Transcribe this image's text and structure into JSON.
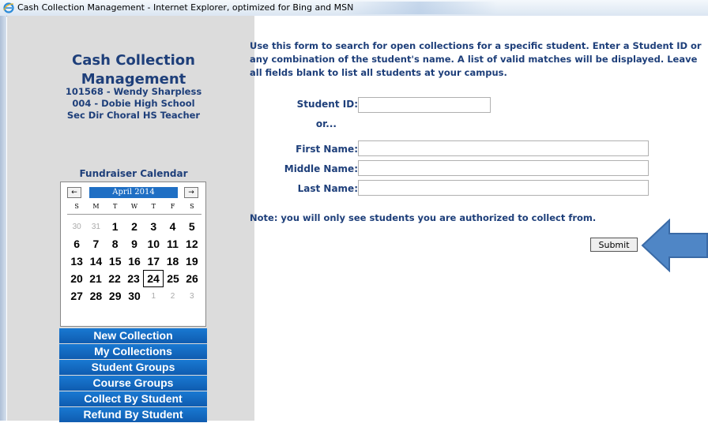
{
  "window": {
    "title": "Cash Collection Management - Internet Explorer, optimized for Bing and MSN"
  },
  "sidebar": {
    "app_title": "Cash Collection Management",
    "user_line1": "101568 - Wendy Sharpless",
    "user_line2": "004 - Dobie High School",
    "user_line3": "Sec Dir Choral HS Teacher",
    "calendar_heading": "Fundraiser Calendar",
    "calendar": {
      "month": "April 2014",
      "prev_label": "←",
      "next_label": "→",
      "days_of_week": [
        "S",
        "M",
        "T",
        "W",
        "T",
        "F",
        "S"
      ],
      "today": 24,
      "weeks": [
        [
          {
            "d": "30",
            "o": true
          },
          {
            "d": "31",
            "o": true
          },
          {
            "d": "1"
          },
          {
            "d": "2"
          },
          {
            "d": "3"
          },
          {
            "d": "4"
          },
          {
            "d": "5"
          }
        ],
        [
          {
            "d": "6"
          },
          {
            "d": "7"
          },
          {
            "d": "8"
          },
          {
            "d": "9"
          },
          {
            "d": "10"
          },
          {
            "d": "11"
          },
          {
            "d": "12"
          }
        ],
        [
          {
            "d": "13"
          },
          {
            "d": "14"
          },
          {
            "d": "15"
          },
          {
            "d": "16"
          },
          {
            "d": "17"
          },
          {
            "d": "18"
          },
          {
            "d": "19"
          }
        ],
        [
          {
            "d": "20"
          },
          {
            "d": "21"
          },
          {
            "d": "22"
          },
          {
            "d": "23"
          },
          {
            "d": "24"
          },
          {
            "d": "25"
          },
          {
            "d": "26"
          }
        ],
        [
          {
            "d": "27"
          },
          {
            "d": "28"
          },
          {
            "d": "29"
          },
          {
            "d": "30"
          },
          {
            "d": "1",
            "o": true
          },
          {
            "d": "2",
            "o": true
          },
          {
            "d": "3",
            "o": true
          }
        ]
      ]
    },
    "nav": [
      "New Collection",
      "My Collections",
      "Student Groups",
      "Course Groups",
      "Collect By Student",
      "Refund By Student"
    ]
  },
  "main": {
    "intro_line1": "Use this form to search for open collections for a specific student. Enter a Student ID or",
    "intro_line2": "any combination of the student's name. A list of valid matches will be displayed. Leave",
    "intro_line3": "all fields blank to list all students at your campus.",
    "student_id_label": "Student ID:",
    "or_label": "or...",
    "first_name_label": "First Name:",
    "middle_name_label": "Middle Name:",
    "last_name_label": "Last Name:",
    "student_id_value": "",
    "first_name_value": "",
    "middle_name_value": "",
    "last_name_value": "",
    "note": "Note: you will only see students you are authorized to collect from.",
    "submit_label": "Submit"
  },
  "colors": {
    "heading": "#1e3f7a",
    "nav_bg": "#1979d2",
    "arrow": "#4f86c6",
    "sidebar_bg": "#dcdcdc"
  },
  "icons": {
    "browser": "internet-explorer-icon",
    "pointer": "arrow-pointer-icon"
  }
}
